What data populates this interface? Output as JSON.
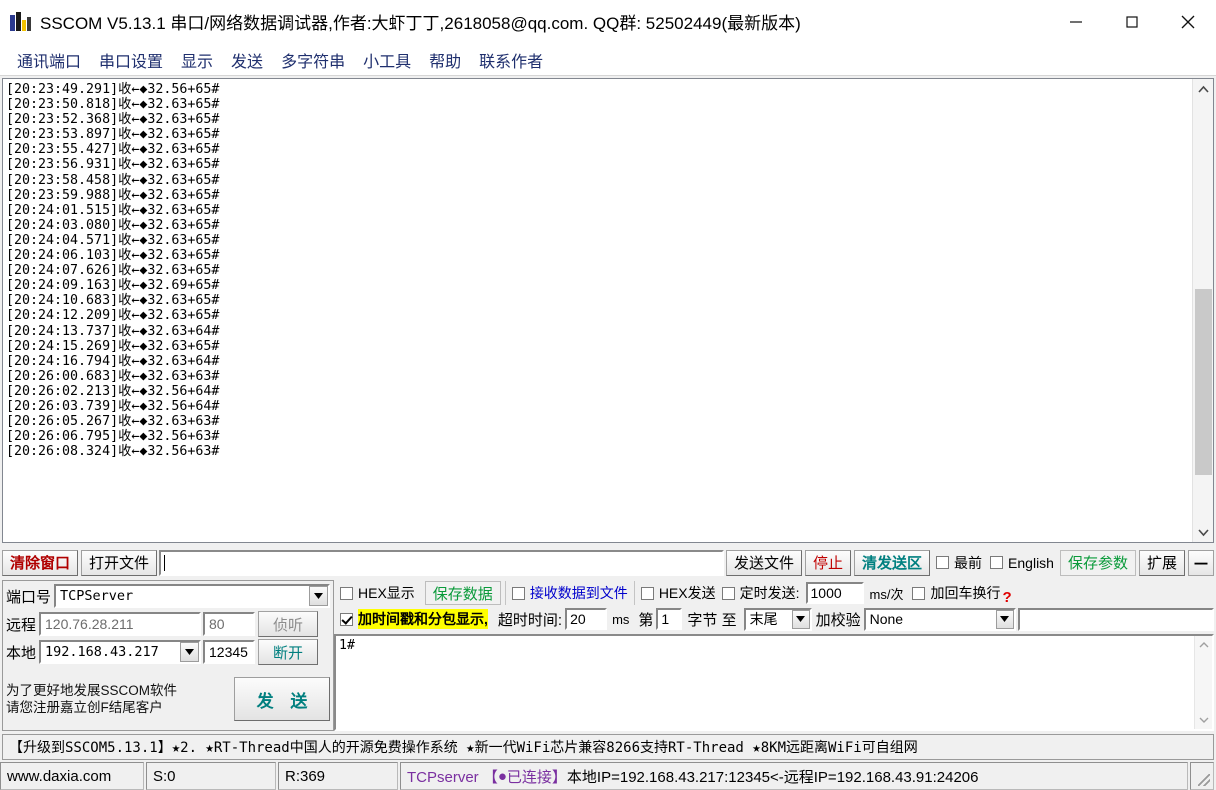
{
  "window": {
    "title": "SSCOM V5.13.1 串口/网络数据调试器,作者:大虾丁丁,2618058@qq.com. QQ群: 52502449(最新版本)",
    "minimize_label": "—",
    "maximize_label": "□",
    "close_label": "✕"
  },
  "menu": {
    "items": [
      {
        "label": "通讯端口"
      },
      {
        "label": "串口设置"
      },
      {
        "label": "显示"
      },
      {
        "label": "发送"
      },
      {
        "label": "多字符串"
      },
      {
        "label": "小工具"
      },
      {
        "label": "帮助"
      },
      {
        "label": "联系作者"
      }
    ]
  },
  "log": {
    "lines": [
      "[20:23:49.291]收←◆32.56+65#",
      "[20:23:50.818]收←◆32.63+65#",
      "[20:23:52.368]收←◆32.63+65#",
      "[20:23:53.897]收←◆32.63+65#",
      "[20:23:55.427]收←◆32.63+65#",
      "[20:23:56.931]收←◆32.63+65#",
      "[20:23:58.458]收←◆32.63+65#",
      "[20:23:59.988]收←◆32.63+65#",
      "[20:24:01.515]收←◆32.63+65#",
      "[20:24:03.080]收←◆32.63+65#",
      "[20:24:04.571]收←◆32.63+65#",
      "[20:24:06.103]收←◆32.63+65#",
      "[20:24:07.626]收←◆32.63+65#",
      "[20:24:09.163]收←◆32.69+65#",
      "[20:24:10.683]收←◆32.63+65#",
      "[20:24:12.209]收←◆32.63+65#",
      "[20:24:13.737]收←◆32.63+64#",
      "[20:24:15.269]收←◆32.63+65#",
      "[20:24:16.794]收←◆32.63+64#",
      "[20:26:00.683]收←◆32.63+63#",
      "[20:26:02.213]收←◆32.56+64#",
      "[20:26:03.739]收←◆32.56+64#",
      "[20:26:05.267]收←◆32.63+63#",
      "[20:26:06.795]收←◆32.56+63#",
      "[20:26:08.324]收←◆32.56+63#"
    ],
    "scroll_up_icon": "▲",
    "scroll_down_icon": "▼"
  },
  "toolbar": {
    "clear_window": "清除窗口",
    "open_file": "打开文件",
    "file_path_value": "",
    "send_file": "发送文件",
    "stop": "停止",
    "clear_send": "清发送区",
    "topmost_label": "最前",
    "topmost_checked": false,
    "english_label": "English",
    "english_checked": false,
    "save_params": "保存参数",
    "extend": "扩展",
    "minimize_panel": "－"
  },
  "connection": {
    "port_label": "端口号",
    "port_value": "TCPServer",
    "remote_label": "远程",
    "remote_ip": "120.76.28.211",
    "remote_port": "80",
    "listen_button": "侦听",
    "local_label": "本地",
    "local_ip": "192.168.43.217",
    "local_port": "12345",
    "disconnect_button": "断开",
    "promo_line1": "为了更好地发展SSCOM软件",
    "promo_line2": "请您注册嘉立创F结尾客户",
    "send_button": "发 送"
  },
  "options": {
    "hex_display_label": "HEX显示",
    "hex_display_checked": false,
    "save_data_button": "保存数据",
    "recv_to_file_label": "接收数据到文件",
    "recv_to_file_checked": false,
    "hex_send_label": "HEX发送",
    "hex_send_checked": false,
    "timed_send_label": "定时发送:",
    "timed_send_checked": false,
    "timed_send_value": "1000",
    "timed_send_unit": "ms/次",
    "crlf_label": "加回车换行",
    "crlf_checked": false,
    "help_mark": "?",
    "timestamp_label": "加时间戳和分包显示,",
    "timestamp_checked": true,
    "timeout_label": "超时时间:",
    "timeout_value": "20",
    "timeout_unit": "ms",
    "byte_from_label": "第",
    "byte_from_value": "1",
    "byte_mid_label": "字节 至",
    "byte_to_value": "末尾",
    "checksum_label": "加校验",
    "checksum_value": "None"
  },
  "send_box": {
    "content": "1#",
    "scroll_up_icon": "⌃",
    "scroll_down_icon": "⌄"
  },
  "banner": {
    "text": "【升级到SSCOM5.13.1】★2.  ★RT-Thread中国人的开源免费操作系统 ★新一代WiFi芯片兼容8266支持RT-Thread ★8KM远距离WiFi可自组网"
  },
  "status": {
    "website": "www.daxia.com",
    "sent": "S:0",
    "received": "R:369",
    "connection_prefix": "TCPserver 【",
    "connection_dot": "●",
    "connection_state": "已连接】",
    "connection_detail": "本地IP=192.168.43.217:12345<-远程IP=192.168.43.91:24206"
  },
  "colors": {
    "accent_red": "#b00000",
    "accent_teal": "#008080",
    "accent_green": "#0a9a3a",
    "accent_blue": "#0000cc",
    "highlight_yellow": "#ffff00",
    "menu_navy": "#1f2f6e",
    "status_purple": "#7a2fa0"
  }
}
